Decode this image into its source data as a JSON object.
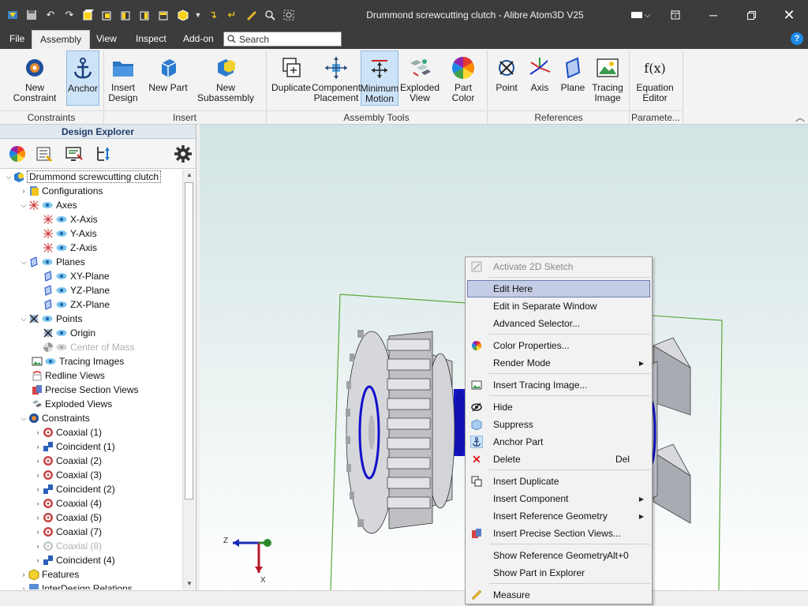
{
  "window": {
    "title": "Drummond screwcutting clutch - Alibre Atom3D V25"
  },
  "menu": {
    "items": [
      "File",
      "Assembly",
      "View",
      "Inspect",
      "Add-on"
    ],
    "search_placeholder": "Search",
    "help": "?"
  },
  "ribbon": {
    "groups": {
      "constraints": "Constraints",
      "insert": "Insert",
      "assembly_tools": "Assembly Tools",
      "references": "References",
      "parameters": "Paramete..."
    },
    "buttons": {
      "new_constraint": "New Constraint",
      "anchor": "Anchor",
      "insert_design": "Insert\nDesign",
      "new_part": "New Part",
      "new_subassembly": "New Subassembly",
      "duplicate": "Duplicate",
      "component_placement": "Component\nPlacement",
      "minimum_motion": "Minimum\nMotion",
      "exploded_view": "Exploded\nView",
      "part_color": "Part Color",
      "point": "Point",
      "axis": "Axis",
      "plane": "Plane",
      "tracing_image": "Tracing\nImage",
      "equation_editor": "Equation\nEditor",
      "equation_icon": "f(x)"
    }
  },
  "explorer": {
    "title": "Design Explorer",
    "tree": [
      {
        "label": "Drummond screwcutting clutch"
      },
      {
        "label": "Configurations"
      },
      {
        "label": "Axes"
      },
      {
        "label": "X-Axis"
      },
      {
        "label": "Y-Axis"
      },
      {
        "label": "Z-Axis"
      },
      {
        "label": "Planes"
      },
      {
        "label": "XY-Plane"
      },
      {
        "label": "YZ-Plane"
      },
      {
        "label": "ZX-Plane"
      },
      {
        "label": "Points"
      },
      {
        "label": "Origin"
      },
      {
        "label": "Center of Mass"
      },
      {
        "label": "Tracing Images"
      },
      {
        "label": "Redline Views"
      },
      {
        "label": "Precise Section Views"
      },
      {
        "label": "Exploded Views"
      },
      {
        "label": "Constraints"
      },
      {
        "label": "Coaxial (1)"
      },
      {
        "label": "Coincident (1)"
      },
      {
        "label": "Coaxial (2)"
      },
      {
        "label": "Coaxial (3)"
      },
      {
        "label": "Coincident (2)"
      },
      {
        "label": "Coaxial (4)"
      },
      {
        "label": "Coaxial (5)"
      },
      {
        "label": "Coaxial (7)"
      },
      {
        "label": "Coaxial (8)"
      },
      {
        "label": "Coincident (4)"
      },
      {
        "label": "Features"
      },
      {
        "label": "InterDesign Relations"
      }
    ]
  },
  "triad": {
    "z": "Z",
    "x": "X"
  },
  "context_menu": {
    "items": [
      {
        "label": "Activate 2D Sketch"
      },
      {
        "label": "Edit Here"
      },
      {
        "label": "Edit in Separate Window"
      },
      {
        "label": "Advanced Selector..."
      },
      {
        "label": "Color Properties..."
      },
      {
        "label": "Render Mode"
      },
      {
        "label": "Insert Tracing Image..."
      },
      {
        "label": "Hide"
      },
      {
        "label": "Suppress"
      },
      {
        "label": "Anchor Part"
      },
      {
        "label": "Delete",
        "shortcut": "Del"
      },
      {
        "label": "Insert Duplicate"
      },
      {
        "label": "Insert Component"
      },
      {
        "label": "Insert Reference Geometry"
      },
      {
        "label": "Insert Precise Section Views..."
      },
      {
        "label": "Show Reference Geometry",
        "shortcut": "Alt+0"
      },
      {
        "label": "Show Part in Explorer"
      },
      {
        "label": "Measure"
      }
    ]
  },
  "colors": {
    "titlebar": "#3c3c3c",
    "selection": "#cde3f7",
    "menu_highlight": "#c5cde6",
    "part_blue": "#0000cc"
  }
}
